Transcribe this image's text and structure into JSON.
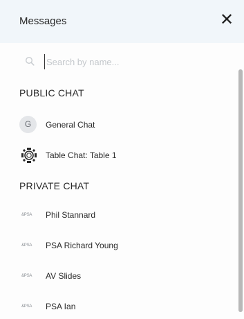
{
  "header": {
    "title": "Messages",
    "close_label": "✕"
  },
  "search": {
    "placeholder": "Search by name..."
  },
  "public_chat": {
    "title": "PUBLIC CHAT",
    "items": [
      {
        "avatar_letter": "G",
        "label": "General Chat",
        "icon": "letter-avatar"
      },
      {
        "label": "Table Chat: Table 1",
        "icon": "table-icon"
      }
    ]
  },
  "private_chat": {
    "title": "PRIVATE CHAT",
    "logo_text": "&PSA",
    "items": [
      {
        "label": "Phil Stannard",
        "icon": "psa-logo"
      },
      {
        "label": "PSA Richard Young",
        "icon": "psa-logo"
      },
      {
        "label": "AV Slides",
        "icon": "psa-logo"
      },
      {
        "label": "PSA Ian",
        "icon": "psa-logo"
      }
    ]
  },
  "colors": {
    "header_bg": "#f1f6fa",
    "scrollbar": "#b8b8b8",
    "placeholder": "#c4c8cc"
  }
}
